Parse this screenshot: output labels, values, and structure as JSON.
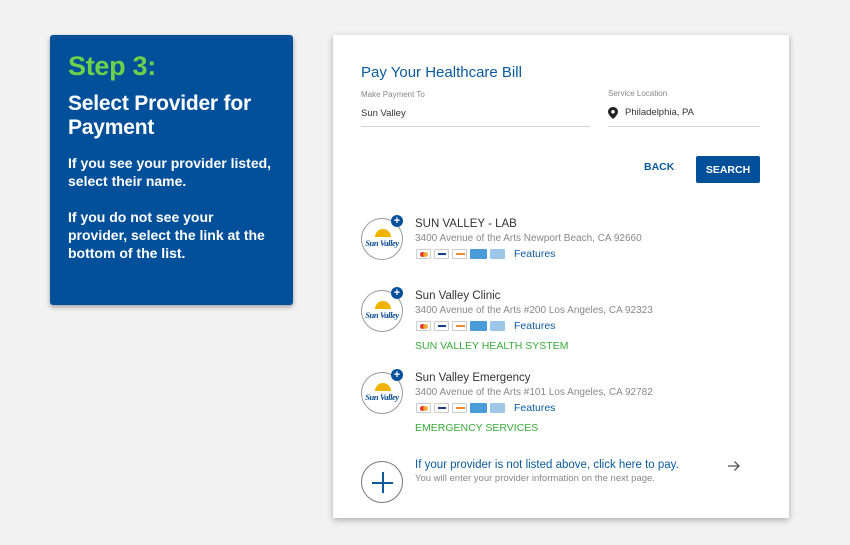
{
  "step_panel": {
    "step": "Step 3:",
    "title": "Select Provider for Payment",
    "text1": "If you see your provider listed, select their name.",
    "text2": "If you do not see your provider, select the link at the bottom of the list."
  },
  "card": {
    "title": "Pay Your Healthcare Bill",
    "make_payment_label": "Make Payment To",
    "make_payment_value": "Sun Valley",
    "service_location_label": "Service Location",
    "service_location_value": "Philadelphia, PA",
    "back_label": "BACK",
    "search_label": "SEARCH"
  },
  "providers": [
    {
      "logo_text": "Sun Valley",
      "name": "SUN VALLEY - LAB",
      "address": "3400 Avenue of the Arts Newport Beach, CA 92660",
      "features": "Features",
      "system": ""
    },
    {
      "logo_text": "Sun Valley",
      "name": "Sun Valley Clinic",
      "address": "3400 Avenue of the Arts #200 Los Angeles, CA 92323",
      "features": "Features",
      "system": "SUN VALLEY HEALTH SYSTEM"
    },
    {
      "logo_text": "Sun Valley",
      "name": "Sun Valley Emergency",
      "address": "3400 Avenue of the Arts #101 Los Angeles, CA 92782",
      "features": "Features",
      "system": "EMERGENCY SERVICES"
    }
  ],
  "not_listed": {
    "link": "If your provider is not listed above, click here to pay.",
    "sub": "You will enter your provider information on the next page."
  },
  "colors": {
    "brand_blue": "#03509a",
    "step_green": "#6cd04a",
    "link_blue": "#0a5a9c",
    "system_green": "#3aab3a"
  }
}
